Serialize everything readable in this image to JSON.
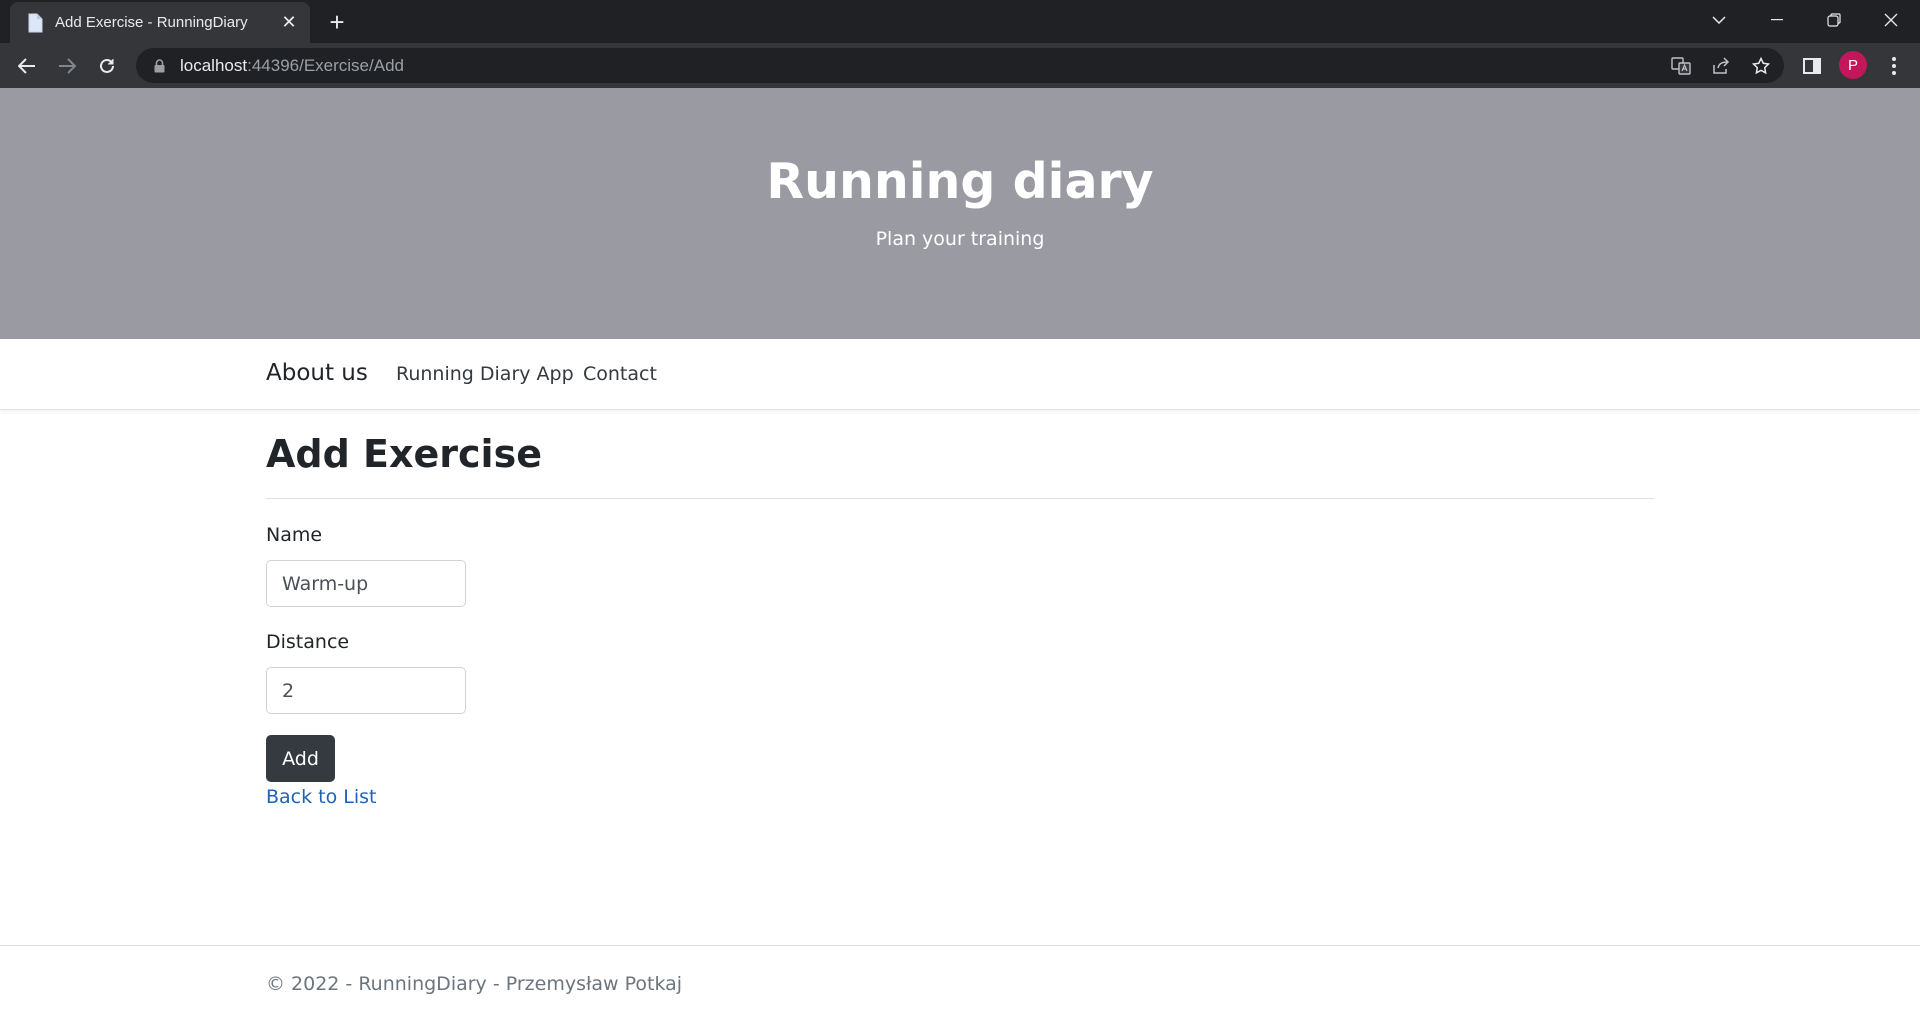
{
  "browser": {
    "tab_title": "Add Exercise - RunningDiary",
    "new_tab": "+",
    "tab_close": "✕",
    "url_host": "localhost",
    "url_rest": ":44396/Exercise/Add",
    "profile_initial": "P",
    "colors": {
      "frame": "#202124",
      "toolbar": "#35363a",
      "avatar": "#c2185b"
    }
  },
  "header": {
    "title": "Running diary",
    "subtitle": "Plan your training",
    "background": "#9a9aa3"
  },
  "nav": {
    "brand": "About us",
    "links": [
      "Running Diary App",
      "Contact"
    ]
  },
  "main": {
    "title": "Add Exercise",
    "fields": [
      {
        "label": "Name",
        "value": "Warm-up"
      },
      {
        "label": "Distance",
        "value": "2"
      }
    ],
    "submit_label": "Add",
    "back_link": "Back to List",
    "colors": {
      "button": "#343a40",
      "link": "#1e63b8"
    }
  },
  "footer": {
    "text": "© 2022 - RunningDiary - Przemysław Potkaj"
  }
}
